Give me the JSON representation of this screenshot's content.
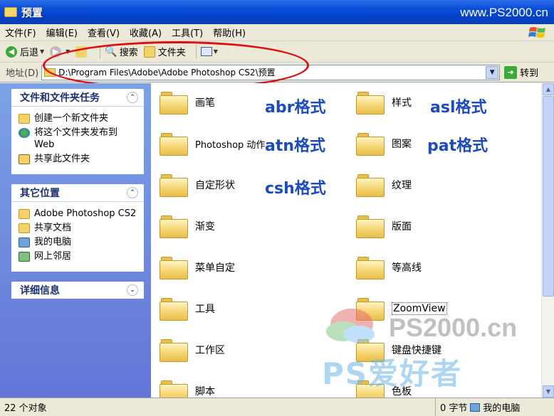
{
  "window": {
    "title": "预置",
    "watermark": "www.PS2000.cn"
  },
  "menu": [
    "文件(F)",
    "编辑(E)",
    "查看(V)",
    "收藏(A)",
    "工具(T)",
    "帮助(H)"
  ],
  "toolbar": {
    "back": "后退",
    "search": "搜索",
    "folders": "文件夹"
  },
  "address": {
    "label": "地址(D)",
    "path": "D:\\Program Files\\Adobe\\Adobe Photoshop CS2\\预置",
    "go": "转到"
  },
  "tasks": {
    "title": "文件和文件夹任务",
    "items": [
      "创建一个新文件夹",
      "将这个文件夹发布到 Web",
      "共享此文件夹"
    ]
  },
  "places": {
    "title": "其它位置",
    "items": [
      "Adobe Photoshop CS2",
      "共享文档",
      "我的电脑",
      "网上邻居"
    ]
  },
  "details": {
    "title": "详细信息"
  },
  "folders": {
    "left": [
      "画笔",
      "Photoshop 动作",
      "自定形状",
      "渐变",
      "菜单自定",
      "工具",
      "工作区",
      "脚本"
    ],
    "right": [
      "样式",
      "图案",
      "纹理",
      "版面",
      "等高线",
      "ZoomView",
      "键盘快捷键",
      "色板"
    ]
  },
  "annotations": {
    "abr": "abr格式",
    "atn": "atn格式",
    "csh": "csh格式",
    "asl": "asl格式",
    "pat": "pat格式"
  },
  "status": {
    "objects": "22 个对象",
    "size": "0 字节",
    "location": "我的电脑"
  },
  "watermark": {
    "brand": "PS2000.cn",
    "slogan": "PS爱好者"
  }
}
